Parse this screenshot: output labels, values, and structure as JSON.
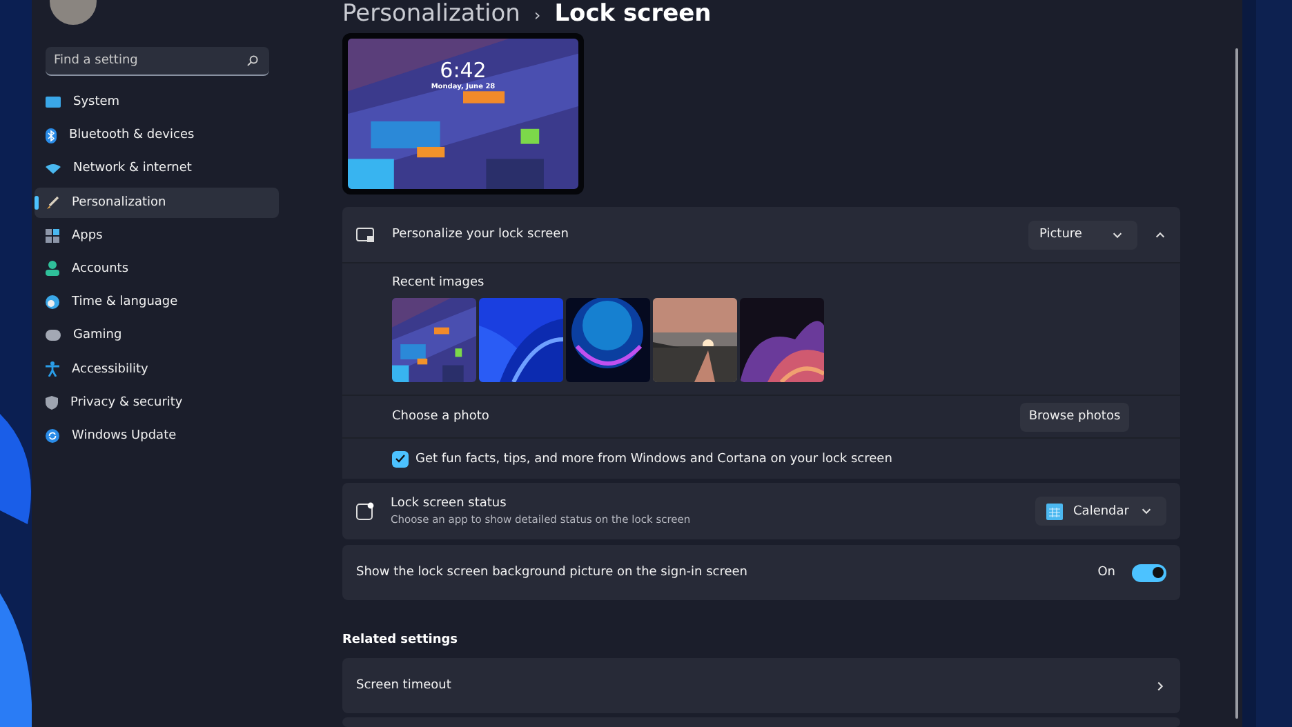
{
  "sidebar": {
    "search": {
      "placeholder": "Find a setting"
    },
    "items": [
      {
        "label": "System",
        "selected": false
      },
      {
        "label": "Bluetooth & devices",
        "selected": false
      },
      {
        "label": "Network & internet",
        "selected": false
      },
      {
        "label": "Personalization",
        "selected": true
      },
      {
        "label": "Apps",
        "selected": false
      },
      {
        "label": "Accounts",
        "selected": false
      },
      {
        "label": "Time & language",
        "selected": false
      },
      {
        "label": "Gaming",
        "selected": false
      },
      {
        "label": "Accessibility",
        "selected": false
      },
      {
        "label": "Privacy & security",
        "selected": false
      },
      {
        "label": "Windows Update",
        "selected": false
      }
    ]
  },
  "breadcrumb": {
    "parent": "Personalization",
    "separator": "›",
    "current": "Lock screen"
  },
  "preview": {
    "time": "6:42",
    "date": "Monday, June 28"
  },
  "personalize": {
    "title": "Personalize your lock screen",
    "dropdown": "Picture",
    "expanded": true,
    "recent_images_label": "Recent images",
    "choose_photo_label": "Choose a photo",
    "browse_button": "Browse photos",
    "fun_facts": {
      "label": "Get fun facts, tips, and more from Windows and Cortana on your lock screen",
      "checked": true
    }
  },
  "status": {
    "title": "Lock screen status",
    "subtitle": "Choose an app to show detailed status on the lock screen",
    "dropdown": "Calendar"
  },
  "signin_background": {
    "label": "Show the lock screen background picture on the sign-in screen",
    "state_label": "On",
    "on": true
  },
  "related_settings": {
    "heading": "Related settings",
    "items": [
      "Screen timeout"
    ]
  }
}
